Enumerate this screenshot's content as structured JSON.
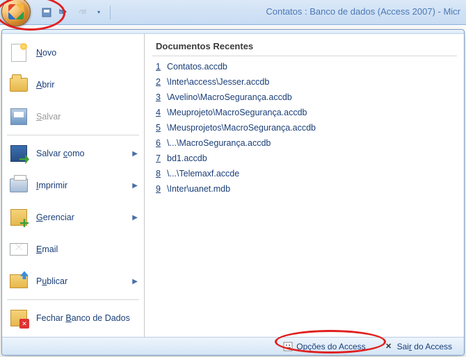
{
  "app": {
    "title": "Contatos : Banco de dados (Access 2007) - Micr"
  },
  "menu": {
    "new": {
      "pre": "",
      "u": "N",
      "post": "ovo"
    },
    "open": {
      "pre": "",
      "u": "A",
      "post": "brir"
    },
    "save": {
      "pre": "",
      "u": "S",
      "post": "alvar"
    },
    "saveas": {
      "pre": "Salvar ",
      "u": "c",
      "post": "omo"
    },
    "print": {
      "pre": "",
      "u": "I",
      "post": "mprimir"
    },
    "manage": {
      "pre": "",
      "u": "G",
      "post": "erenciar"
    },
    "email": {
      "pre": "",
      "u": "E",
      "post": "mail"
    },
    "publish": {
      "pre": "P",
      "u": "u",
      "post": "blicar"
    },
    "close": {
      "pre": "Fechar ",
      "u": "B",
      "post": "anco de Dados"
    }
  },
  "recent": {
    "header": "Documentos Recentes",
    "items": [
      {
        "n": "1",
        "name": "Contatos.accdb"
      },
      {
        "n": "2",
        "name": "\\Inter\\access\\Jesser.accdb"
      },
      {
        "n": "3",
        "name": "\\Avelino\\MacroSegurança.accdb"
      },
      {
        "n": "4",
        "name": "\\Meuprojeto\\MacroSegurança.accdb"
      },
      {
        "n": "5",
        "name": "\\Meusprojetos\\MacroSegurança.accdb"
      },
      {
        "n": "6",
        "name": "\\...\\MacroSegurança.accdb"
      },
      {
        "n": "7",
        "name": "bd1.accdb"
      },
      {
        "n": "8",
        "name": "\\...\\Telemaxf.accde"
      },
      {
        "n": "9",
        "name": "\\Inter\\uanet.mdb"
      }
    ]
  },
  "footer": {
    "options": {
      "pre": "",
      "u": "O",
      "post": "pções do Access"
    },
    "exit": {
      "pre": "Sai",
      "u": "r",
      "post": " do Access"
    }
  }
}
